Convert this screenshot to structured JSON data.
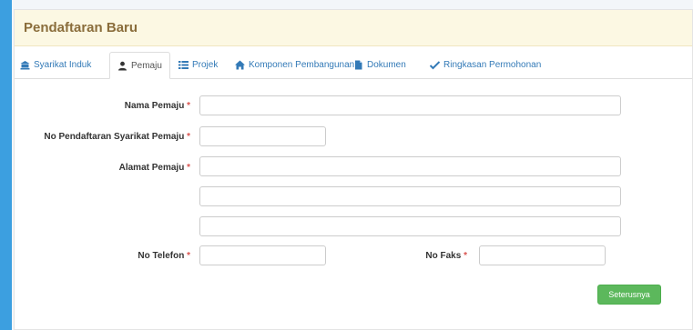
{
  "panel": {
    "title": "Pendaftaran Baru"
  },
  "tabs": [
    {
      "label": "Syarikat Induk",
      "icon": "bank-icon"
    },
    {
      "label": "Pemaju",
      "icon": "user-icon",
      "active": true
    },
    {
      "label": "Projek",
      "icon": "list-icon"
    },
    {
      "label": "Komponen Pembangunan",
      "icon": "home-icon"
    },
    {
      "label": "Dokumen",
      "icon": "file-icon"
    },
    {
      "label": "Ringkasan Permohonan",
      "icon": "check-icon"
    }
  ],
  "form": {
    "nama_pemaju": {
      "label": "Nama Pemaju",
      "required": "*",
      "value": ""
    },
    "no_pendaftaran": {
      "label": "No Pendaftaran Syarikat Pemaju",
      "required": "*",
      "value": ""
    },
    "alamat": {
      "label": "Alamat Pemaju",
      "required": "*",
      "line1": "",
      "line2": "",
      "line3": ""
    },
    "no_telefon": {
      "label": "No Telefon",
      "required": "*",
      "value": ""
    },
    "no_faks": {
      "label": "No Faks",
      "required": "*",
      "value": ""
    }
  },
  "buttons": {
    "next_label": "Seterusnya"
  },
  "colors": {
    "accent": "#3c9fe0",
    "link": "#337ab7",
    "success": "#5cb85c",
    "heading_bg": "#fcf8e3",
    "heading_text": "#8a6d3b",
    "required": "#d9534f"
  }
}
